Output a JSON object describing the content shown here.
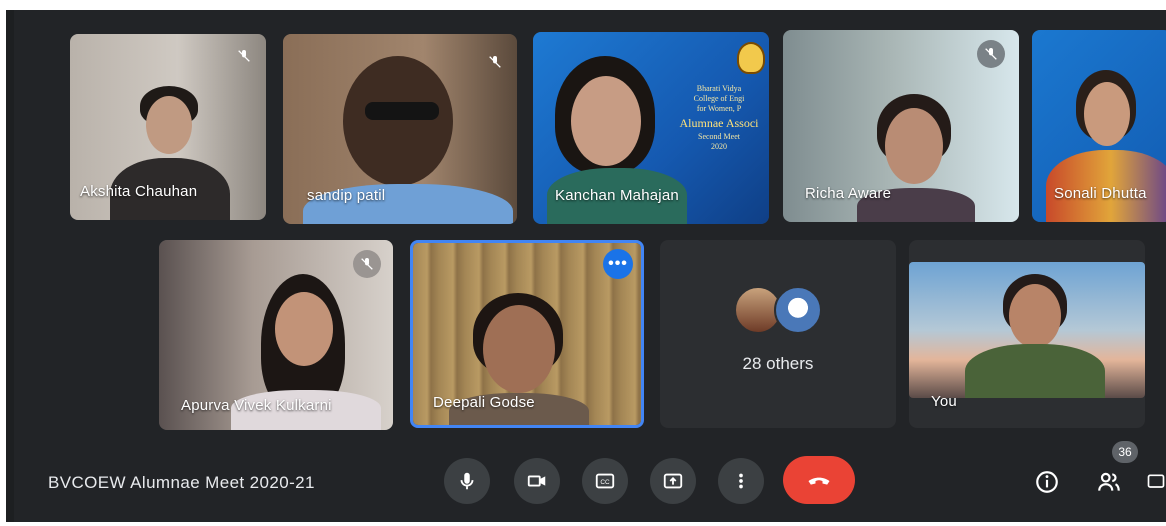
{
  "meeting": {
    "title": "BVCOEW Alumnae Meet 2020-21"
  },
  "participants": [
    {
      "name": "Akshita Chauhan",
      "muted": true
    },
    {
      "name": "sandip patil",
      "muted": true
    },
    {
      "name": "Kanchan Mahajan",
      "muted": false
    },
    {
      "name": "Richa Aware",
      "muted": true
    },
    {
      "name": "Sonali Dhutta",
      "muted": false
    },
    {
      "name": "Apurva Vivek Kulkarni",
      "muted": true
    },
    {
      "name": "Deepali Godse",
      "muted": false,
      "active_speaker": true
    },
    {
      "name": "You",
      "muted": false
    }
  ],
  "others_tile": {
    "label": "28 others"
  },
  "slide_background": {
    "lines": [
      "Bharati Vidya",
      "College of Engi",
      "for Women, P",
      "Alumnae Associ",
      "Second Meet",
      "2020"
    ]
  },
  "controls": {
    "icons": [
      "microphone-icon",
      "camera-icon",
      "captions-icon",
      "present-screen-icon",
      "more-options-icon",
      "end-call-icon"
    ]
  },
  "right_panel": {
    "participant_count": "36",
    "icons": [
      "info-icon",
      "people-icon",
      "chat-icon"
    ]
  },
  "colors": {
    "background": "#222427",
    "control_bg": "#3c4043",
    "end_call": "#ea4335",
    "active_border": "#4285f4",
    "slide_blue": "#1565c0"
  }
}
